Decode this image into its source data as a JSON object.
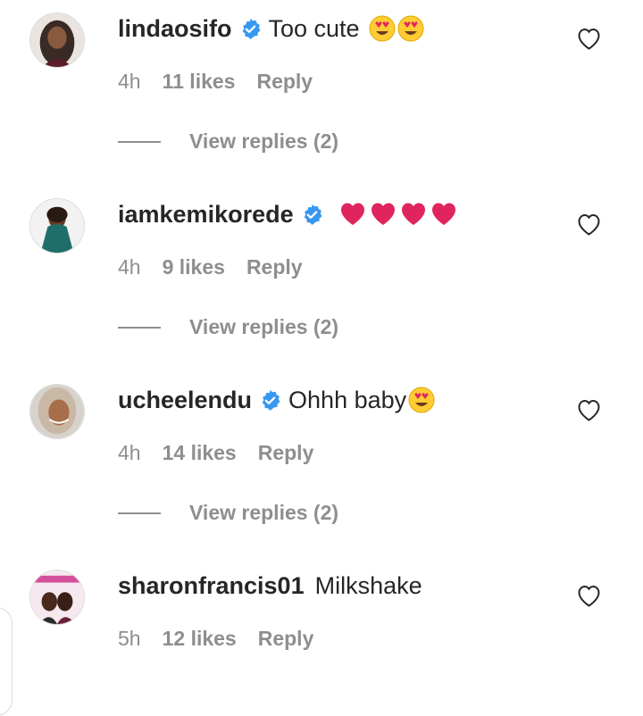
{
  "comments": [
    {
      "username": "lindaosifo",
      "verified": true,
      "text": "Too cute",
      "emojis": [
        "heart-eyes-emoji",
        "heart-eyes-emoji"
      ],
      "time": "4h",
      "likes": "11 likes",
      "reply": "Reply",
      "view_replies": "View replies (2)",
      "avatar_color": "#3a2a25"
    },
    {
      "username": "iamkemikorede",
      "verified": true,
      "text": "",
      "emojis": [
        "red-heart-emoji",
        "red-heart-emoji",
        "red-heart-emoji",
        "red-heart-emoji"
      ],
      "time": "4h",
      "likes": "9 likes",
      "reply": "Reply",
      "view_replies": "View replies (2)",
      "avatar_color": "#1f6e6a"
    },
    {
      "username": "ucheelendu",
      "verified": true,
      "text": "Ohhh baby",
      "emojis": [
        "heart-eyes-emoji"
      ],
      "time": "4h",
      "likes": "14 likes",
      "reply": "Reply",
      "view_replies": "View replies (2)",
      "avatar_color": "#c9b8a6"
    },
    {
      "username": "sharonfrancis01",
      "verified": false,
      "text": "Milkshake",
      "emojis": [],
      "time": "5h",
      "likes": "12 likes",
      "reply": "Reply",
      "avatar_color": "#d44f9a"
    }
  ],
  "colors": {
    "primary_text": "#262626",
    "secondary_text": "#8e8e8e",
    "verified_blue": "#3897f0",
    "heart_red": "#e0245e"
  },
  "icons": {
    "like": "heart-outline-icon",
    "verified": "verified-badge-icon"
  }
}
